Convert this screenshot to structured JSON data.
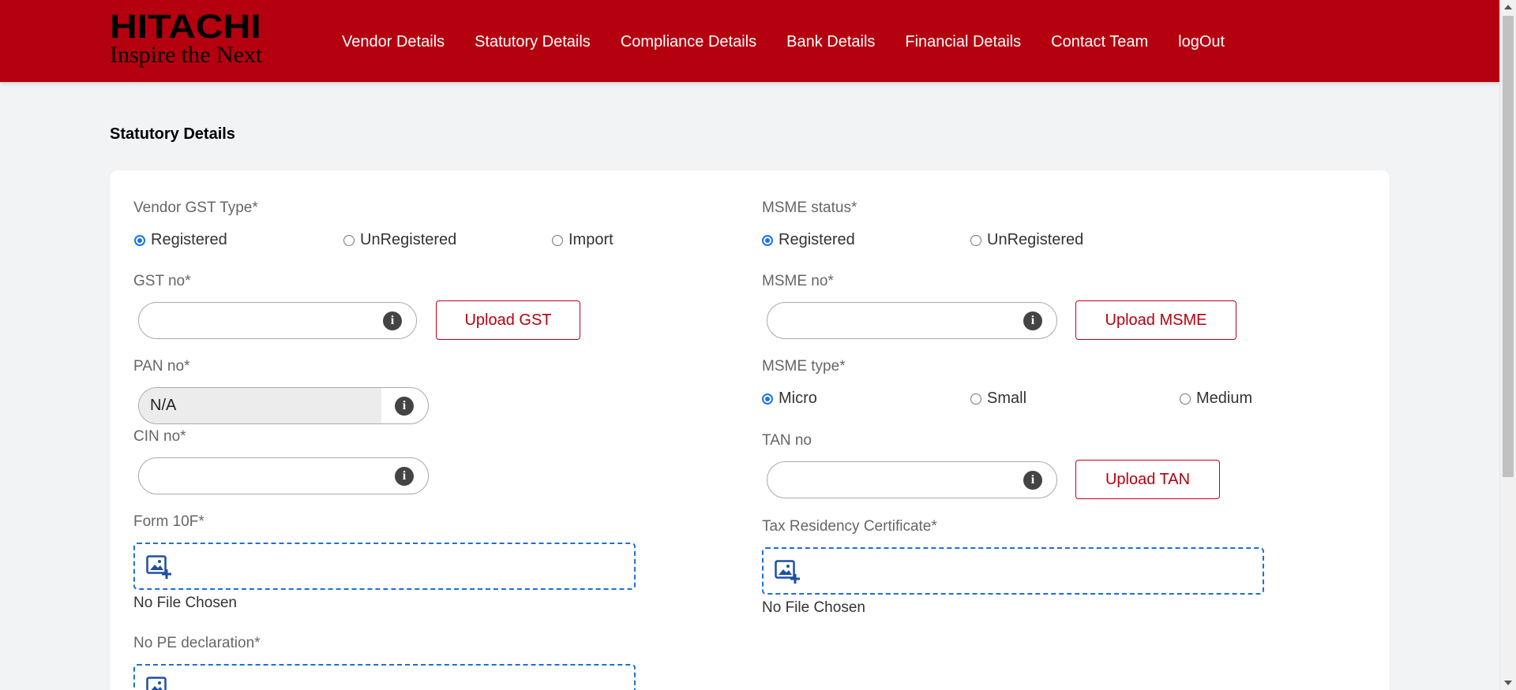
{
  "brand": {
    "name": "HITACHI",
    "tagline": "Inspire the Next"
  },
  "nav": [
    {
      "label": "Vendor Details"
    },
    {
      "label": "Statutory Details"
    },
    {
      "label": "Compliance Details"
    },
    {
      "label": "Bank Details"
    },
    {
      "label": "Financial Details"
    },
    {
      "label": "Contact Team"
    },
    {
      "label": "logOut"
    }
  ],
  "page": {
    "title": "Statutory Details"
  },
  "form": {
    "vendor_gst_type": {
      "label": "Vendor GST Type*",
      "options": [
        "Registered",
        "UnRegistered",
        "Import"
      ],
      "selected": "Registered"
    },
    "gst_no": {
      "label": "GST no*",
      "value": "",
      "upload_label": "Upload GST"
    },
    "pan_no": {
      "label": "PAN no*",
      "value": "N/A"
    },
    "cin_no": {
      "label": "CIN no*",
      "value": ""
    },
    "form_10f": {
      "label": "Form 10F*",
      "status": "No File Chosen"
    },
    "no_pe_declaration": {
      "label": "No PE declaration*"
    },
    "msme_status": {
      "label": "MSME status*",
      "options": [
        "Registered",
        "UnRegistered"
      ],
      "selected": "Registered"
    },
    "msme_no": {
      "label": "MSME no*",
      "value": "",
      "upload_label": "Upload MSME"
    },
    "msme_type": {
      "label": "MSME type*",
      "options": [
        "Micro",
        "Small",
        "Medium"
      ],
      "selected": "Micro"
    },
    "tan_no": {
      "label": "TAN no",
      "value": "",
      "upload_label": "Upload TAN"
    },
    "tax_residency_certificate": {
      "label": "Tax Residency Certificate*",
      "status": "No File Chosen"
    }
  },
  "icons": {
    "info": "info-icon",
    "upload_image": "add-image-icon"
  },
  "colors": {
    "brand_red": "#b5000f",
    "radio_blue": "#1a73e8",
    "dropzone_border": "#1f6fd1"
  }
}
